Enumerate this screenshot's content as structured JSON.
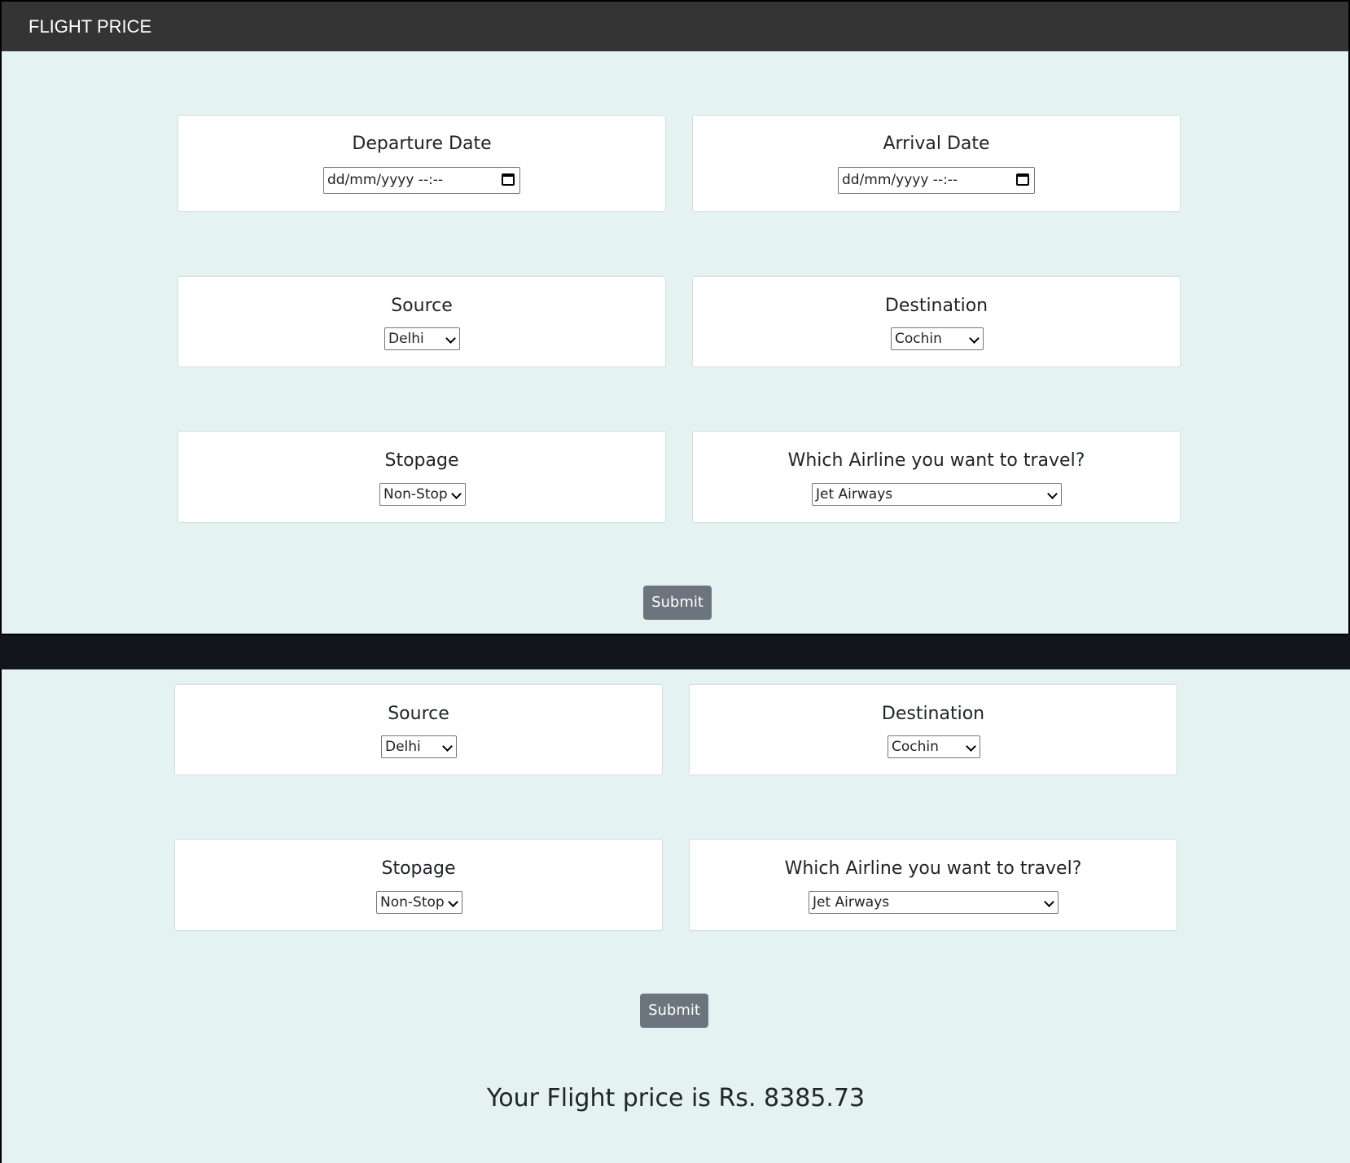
{
  "navbar": {
    "title": "FLIGHT PRICE"
  },
  "form": {
    "departure": {
      "label": "Departure Date",
      "value": "dd/mm/yyyy  --:--"
    },
    "arrival": {
      "label": "Arrival Date",
      "value": "dd/mm/yyyy  --:--"
    },
    "source": {
      "label": "Source",
      "value": "Delhi"
    },
    "destination": {
      "label": "Destination",
      "value": "Cochin"
    },
    "stopage": {
      "label": "Stopage",
      "value": "Non-Stop"
    },
    "airline": {
      "label": "Which Airline you want to travel?",
      "value": "Jet Airways"
    },
    "submit_label": "Submit"
  },
  "result": {
    "text": "Your Flight price is Rs. 8385.73"
  },
  "icons": {
    "calendar": "calendar-icon",
    "dropdown": "chevron-down-icon"
  }
}
